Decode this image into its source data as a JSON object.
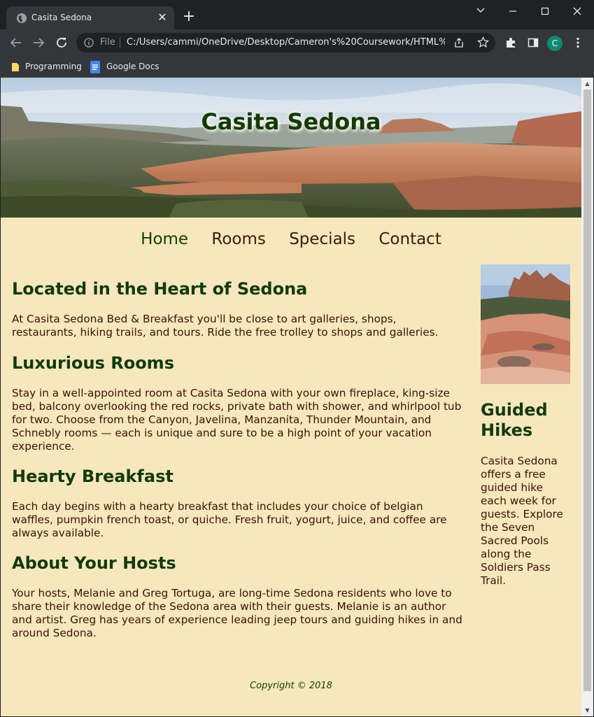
{
  "browser": {
    "tab_title": "Casita Sedona",
    "new_tab_label": "+",
    "url_scheme": "File",
    "url": "C:/Users/cammi/OneDrive/Desktop/Cameron's%20Coursework/HTML%...",
    "profile_initial": "C",
    "bookmarks": [
      "Programming",
      "Google Docs"
    ]
  },
  "site": {
    "title": "Casita Sedona",
    "nav": [
      "Home",
      "Rooms",
      "Specials",
      "Contact"
    ],
    "sections": [
      {
        "heading": "Located in the Heart of Sedona",
        "text": "At Casita Sedona Bed & Breakfast you'll be close to art galleries, shops, restaurants, hiking trails, and tours. Ride the free trolley to shops and galleries."
      },
      {
        "heading": "Luxurious Rooms",
        "text": "Stay in a well-appointed room at Casita Sedona with your own fireplace, king-size bed, balcony overlooking the red rocks, private bath with shower, and whirlpool tub for two. Choose from the Canyon, Javelina, Manzanita, Thunder Mountain, and Schnebly rooms — each is unique and sure to be a high point of your vacation experience."
      },
      {
        "heading": "Hearty Breakfast",
        "text": "Each day begins with a hearty breakfast that includes your choice of belgian waffles, pumpkin french toast, or quiche. Fresh fruit, yogurt, juice, and coffee are always available."
      },
      {
        "heading": "About Your Hosts",
        "text": "Your hosts, Melanie and Greg Tortuga, are long-time Sedona residents who love to share their knowledge of the Sedona area with their guests. Melanie is an author and artist. Greg has years of experience leading jeep tours and guiding hikes in and around Sedona."
      }
    ],
    "aside": {
      "heading": "Guided Hikes",
      "text": "Casita Sedona offers a free guided hike each week for guests. Explore the Seven Sacred Pools along the Soldiers Pass Trail."
    },
    "footer": "Copyright © 2018"
  },
  "colors": {
    "page_background": "#f6e7bd",
    "heading": "#123a0a",
    "body_text": "#3a1200"
  }
}
